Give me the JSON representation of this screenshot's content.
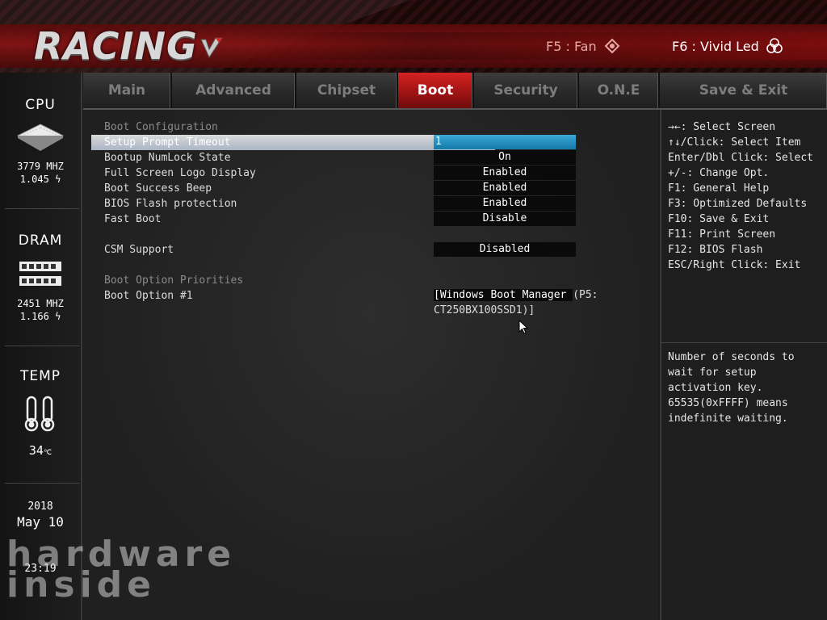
{
  "header": {
    "logo_text": "RACING",
    "f5_label": "F5 : Fan",
    "f6_label": "F6 : Vivid Led"
  },
  "tabs": [
    {
      "label": "Main"
    },
    {
      "label": "Advanced"
    },
    {
      "label": "Chipset"
    },
    {
      "label": "Boot",
      "active": true
    },
    {
      "label": "Security"
    },
    {
      "label": "O.N.E"
    },
    {
      "label": "Save & Exit"
    }
  ],
  "sidebar": {
    "cpu": {
      "title": "CPU",
      "freq": "3779 MHZ",
      "voltage": "1.045"
    },
    "dram": {
      "title": "DRAM",
      "freq": "2451 MHZ",
      "voltage": "1.166"
    },
    "temp": {
      "title": "TEMP",
      "value": "34"
    },
    "date": {
      "year": "2018",
      "month_day": "May 10",
      "time": "23:19"
    }
  },
  "main": {
    "section_boot_config": "Boot Configuration",
    "rows": [
      {
        "label": "Setup Prompt Timeout",
        "value": "1"
      },
      {
        "label": "Bootup NumLock State",
        "value": "On"
      },
      {
        "label": "Full Screen Logo Display",
        "value": "Enabled"
      },
      {
        "label": "Boot Success Beep",
        "value": "Enabled"
      },
      {
        "label": "BIOS Flash protection",
        "value": "Enabled"
      },
      {
        "label": "Fast Boot",
        "value": "Disable"
      }
    ],
    "csm_label": "CSM Support",
    "csm_value": "Disabled",
    "section_boot_priorities": "Boot Option Priorities",
    "boot_option_label": "Boot Option #1",
    "boot_option_value_hl": "[Windows Boot Manager ",
    "boot_option_value_rest": "(P5:",
    "boot_option_value_line2": "CT250BX100SSD1)]"
  },
  "help": {
    "keys": [
      "→←: Select Screen",
      "↑↓/Click: Select Item",
      "Enter/Dbl Click: Select",
      "+/-: Change Opt.",
      "F1: General Help",
      "F3: Optimized Defaults",
      "F10: Save & Exit",
      "F11: Print Screen",
      "F12: BIOS Flash",
      "ESC/Right Click: Exit"
    ],
    "description": [
      "Number of seconds to",
      "wait for setup",
      "activation key.",
      "65535(0xFFFF) means",
      "indefinite waiting."
    ]
  },
  "watermark": {
    "line1": "hardware",
    "line2": "inside"
  }
}
